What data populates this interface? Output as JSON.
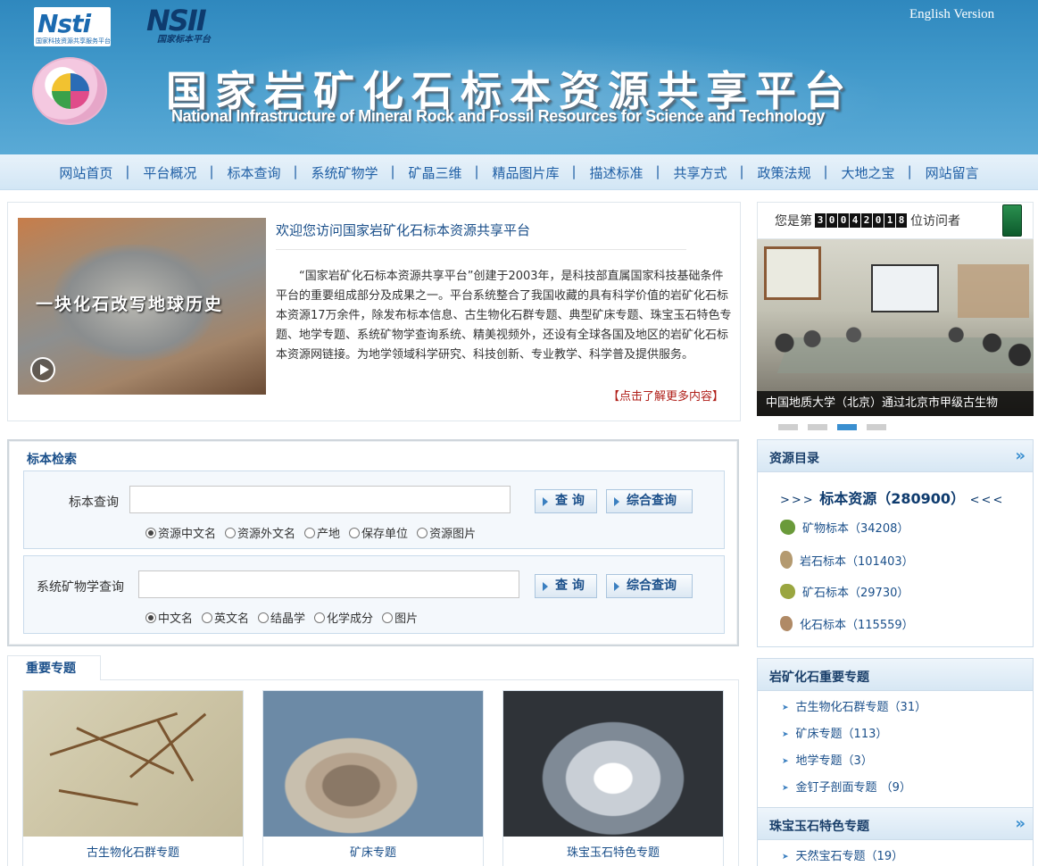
{
  "header": {
    "logo_nsti_text": "Nsti",
    "logo_nsti_sub": "国家科技资源共享服务平台",
    "logo_nsii_text": "NSII",
    "logo_nsii_sub": "国家标本平台",
    "english_link": "English Version",
    "title_cn": "国家岩矿化石标本资源共享平台",
    "title_en": "National Infrastructure of Mineral Rock and Fossil Resources for Science and Technology"
  },
  "nav": {
    "items": [
      "网站首页",
      "平台概况",
      "标本查询",
      "系统矿物学",
      "矿晶三维",
      "精品图片库",
      "描述标准",
      "共享方式",
      "政策法规",
      "大地之宝",
      "网站留言"
    ]
  },
  "welcome": {
    "video_caption": "一块化石改写地球历史",
    "heading": "欢迎您访问国家岩矿化石标本资源共享平台",
    "body": "“国家岩矿化石标本资源共享平台”创建于2003年，是科技部直属国家科技基础条件平台的重要组成部分及成果之一。平台系统整合了我国收藏的具有科学价值的岩矿化石标本资源17万余件，除发布标本信息、古生物化石群专题、典型矿床专题、珠宝玉石特色专题、地学专题、系统矿物学查询系统、精美视频外，还设有全球各国及地区的岩矿化石标本资源网链接。为地学领域科学研究、科技创新、专业教学、科学普及提供服务。",
    "more_link": "【点击了解更多内容】"
  },
  "visitor": {
    "prefix": "您是第",
    "digits": [
      "3",
      "0",
      "0",
      "4",
      "2",
      "0",
      "1",
      "8"
    ],
    "suffix": "位访问者"
  },
  "slideshow": {
    "caption": "中国地质大学（北京）通过北京市甲级古生物",
    "active_index": 2,
    "count": 4
  },
  "search": {
    "title": "标本检索",
    "specimen": {
      "label": "标本查询",
      "value": "",
      "query_btn": "查 询",
      "advanced_btn": "综合查询",
      "options": [
        "资源中文名",
        "资源外文名",
        "产地",
        "保存单位",
        "资源图片"
      ],
      "selected": 0
    },
    "mineralogy": {
      "label": "系统矿物学查询",
      "value": "",
      "query_btn": "查 询",
      "advanced_btn": "综合查询",
      "options": [
        "中文名",
        "英文名",
        "结晶学",
        "化学成分",
        "图片"
      ],
      "selected": 0
    }
  },
  "topics": {
    "tab": "重要专题",
    "cards": [
      {
        "caption": "古生物化石群专题"
      },
      {
        "caption": "矿床专题"
      },
      {
        "caption": "珠宝玉石特色专题"
      }
    ]
  },
  "resources": {
    "title": "资源目录",
    "arrow": "»",
    "total_prefix": ">>>",
    "total_label": "标本资源（280900）",
    "total_suffix": "<<<",
    "items": [
      {
        "label": "矿物标本（34208）",
        "icon": "mineral-icon",
        "color": "#6a9a3a"
      },
      {
        "label": "岩石标本（101403）",
        "icon": "rock-icon",
        "color": "#b49a70"
      },
      {
        "label": "矿石标本（29730）",
        "icon": "ore-icon",
        "color": "#9aa640"
      },
      {
        "label": "化石标本（115559）",
        "icon": "fossil-icon",
        "color": "#b08a66"
      }
    ]
  },
  "important_topics": {
    "title": "岩矿化石重要专题",
    "items": [
      "古生物化石群专题（31）",
      "矿床专题（113）",
      "地学专题（3）",
      "金钉子剖面专题 （9）"
    ]
  },
  "gem_topics": {
    "title": "珠宝玉石特色专题",
    "arrow": "»",
    "items": [
      "天然宝石专题（19）"
    ]
  }
}
